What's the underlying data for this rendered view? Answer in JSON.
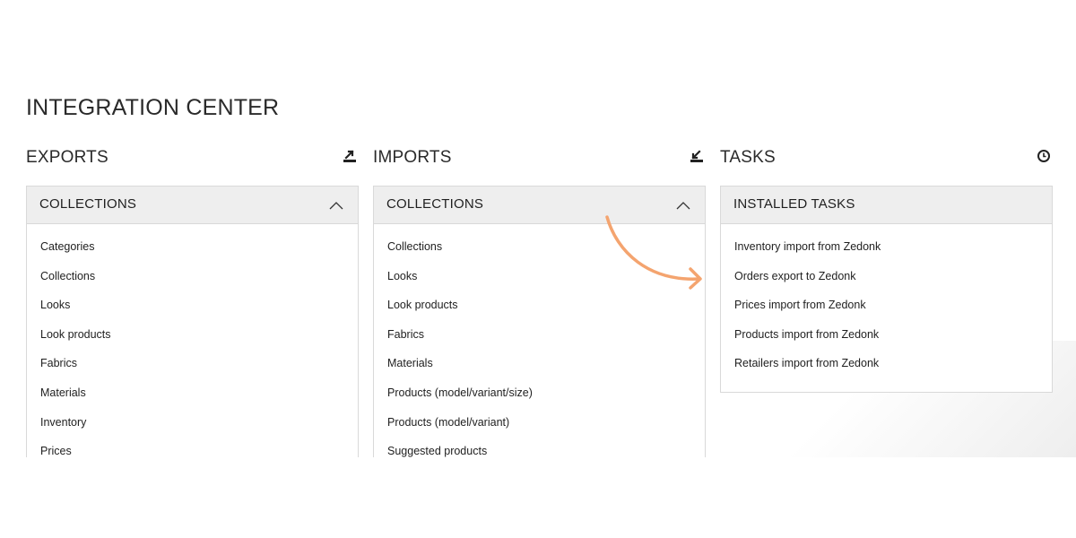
{
  "page": {
    "title": "INTEGRATION CENTER"
  },
  "exports": {
    "title": "EXPORTS",
    "icon": "export-icon",
    "panel": {
      "header": "COLLECTIONS",
      "items": [
        "Categories",
        "Collections",
        "Looks",
        "Look products",
        "Fabrics",
        "Materials",
        "Inventory",
        "Prices"
      ]
    }
  },
  "imports": {
    "title": "IMPORTS",
    "icon": "import-icon",
    "panel": {
      "header": "COLLECTIONS",
      "items": [
        "Collections",
        "Looks",
        "Look products",
        "Fabrics",
        "Materials",
        "Products (model/variant/size)",
        "Products (model/variant)",
        "Suggested products"
      ]
    }
  },
  "tasks": {
    "title": "TASKS",
    "icon": "clock-icon",
    "panel": {
      "header": "INSTALLED TASKS",
      "items": [
        "Inventory import from Zedonk",
        "Orders export to Zedonk",
        "Prices import from Zedonk",
        "Products import from Zedonk",
        "Retailers import from Zedonk"
      ]
    }
  },
  "colors": {
    "annotation_arrow": "#f4a46f",
    "panel_header_bg": "#eeeeee",
    "border": "#d9d9d9"
  }
}
